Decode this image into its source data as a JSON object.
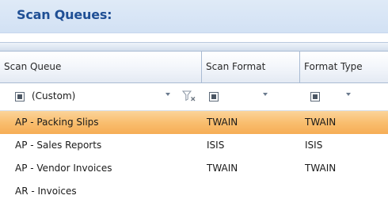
{
  "panel": {
    "title": "Scan Queues:"
  },
  "columns": [
    "Scan Queue",
    "Scan Format",
    "Format Type"
  ],
  "filter_row": {
    "scan_queue_value": "(Custom)"
  },
  "rows": [
    {
      "scan_queue": "AP - Packing Slips",
      "scan_format": "TWAIN",
      "format_type": "TWAIN",
      "selected": true
    },
    {
      "scan_queue": "AP - Sales Reports",
      "scan_format": "ISIS",
      "format_type": "ISIS",
      "selected": false
    },
    {
      "scan_queue": "AP - Vendor Invoices",
      "scan_format": "TWAIN",
      "format_type": "TWAIN",
      "selected": false
    },
    {
      "scan_queue": "AR - Invoices",
      "scan_format": "",
      "format_type": "",
      "selected": false
    }
  ],
  "icons": {
    "filter_checkbox": "checkbox-indeterminate-icon",
    "dropdown": "chevron-down-icon",
    "clear_filter": "clear-filter-icon"
  },
  "colors": {
    "title": "#1f4f95",
    "header_bg": "#dfeaf7",
    "selected_row": "#f9be6f"
  }
}
